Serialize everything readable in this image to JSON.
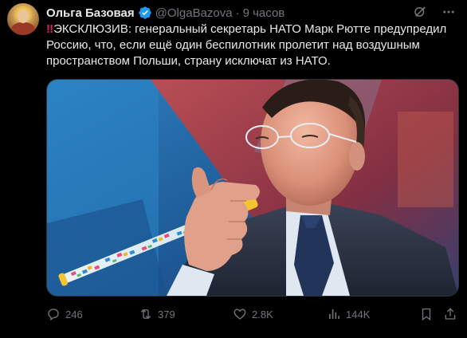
{
  "post": {
    "author": {
      "display_name": "Ольга Базовая",
      "handle": "@OlgaBazova",
      "verified": true,
      "avatar_icon": "icon-avatar"
    },
    "separator": "·",
    "time": "9 часов",
    "alert_symbol": "‼",
    "text_body": "ЭКСКЛЮЗИВ: генеральный секретарь НАТО Марк Рютте предупредил Россию, что, если ещё один беспилотник пролетит над воздушным пространством Польши, страну исключат из НАТО.",
    "top_icons": [
      "grok-icon",
      "more-icon"
    ],
    "media": {
      "description_icon": "photo"
    },
    "actions": {
      "replies": "246",
      "reposts": "379",
      "likes": "2.8K",
      "views": "144K"
    },
    "colors": {
      "background": "#000000",
      "text": "#e7e9ea",
      "muted": "#71767b",
      "verified": "#1d9bf0",
      "alert": "#e0245e"
    }
  }
}
